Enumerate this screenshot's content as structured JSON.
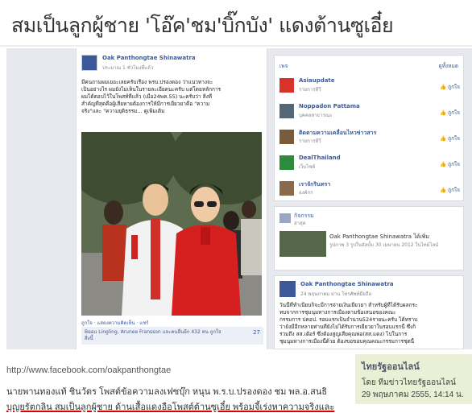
{
  "article": {
    "headline": "สมเป็นลูกผู้ชาย 'โอ๊ค'ชม'บิ๊กบัง' แดงต้านซูเอี๋ย",
    "url": "http://www.facebook.com/oakpanthongtae",
    "body_lines": [
      "นายพานทองแท้ ชินวัตร โพสต์ข้อความลงเฟซบุ๊ก หนุน พ.ร.บ.ปรองดอง ชม พล.อ.สนธิ",
      "บุญยรัตกลิน สมเป็นลูกผู้ชาย ด้านเสื้อแดงอือโพสต์ต้านซูเอี๋ย พร้อมจี้เร่งหาความจริงและ"
    ],
    "credit": {
      "title": "ไทยรัฐออนไลน์",
      "by": "โดย ทีมข่าวไทยรัฐออนไลน์",
      "date": "29 พฤษภาคม 2555, 14:14 น."
    }
  },
  "facebook": {
    "post": {
      "author": "Oak Panthongtae Shinawatra",
      "time": "ประมาณ 1 ชั่วโมงที่แล้ว",
      "text_lines": [
        "มีคนถามผมเยอะเลยครับเรื่อง พรบ.ปรองดอง ว่าแนวทางจะ",
        "เป็นอย่างไร ผมยังไม่เห็นในรายละเอียดนะครับ แต่โดยหลักการ",
        "ผมได้ตอบไว้ในโพสท์ที่แล้ว (เมื่อ24พค.55) นะครับว่า สิ่งที่",
        "สำคัญที่สุดคือผู้เสียหายต้องการให้มีการเยียวยาคือ \"ความ",
        "จริง\"และ \"ความยุติธรรม... ดูเพิ่มเติม"
      ],
      "actions": "ถูกใจ · แสดงความคิดเห็น · แชร์",
      "likes_line1": "Beau Lingling, Arunee Fransson และคนอื่นอีก 432 คน ถูกใจ",
      "likes_line2": "สิ่งนี้",
      "comment_count": "27"
    },
    "pages_panel": {
      "header": "เพจ",
      "see_more": "ดูทั้งหมด",
      "like_label": "ถูกใจ",
      "items": [
        {
          "title": "Asiaupdate",
          "sub": "รายการทีวี",
          "icon_color": "#d8322b"
        },
        {
          "title": "Noppadon Pattama",
          "sub": "บุคคลสาธารณะ",
          "icon_color": "#556677"
        },
        {
          "title": "ติดตามความเคลื่อนไหวข่าวสาร",
          "sub": "รายการทีวี",
          "icon_color": "#7a5c3a"
        },
        {
          "title": "DealThailand",
          "sub": "เว็บไซต์",
          "icon_color": "#2d8b3c"
        },
        {
          "title": "เราจักรินทรา",
          "sub": "องค์กร",
          "icon_color": "#8a6a4a"
        }
      ]
    },
    "activity": {
      "title": "กิจกรรม",
      "sub": "ล่าสุด",
      "name": "Oak Panthongtae Shinawatra ได้เพิ่ม",
      "detail": "รูปภาพ 3 รูปในอัลบั้ม 30 เมษายน 2012 ในไทม์ไลน์"
    },
    "post2": {
      "author": "Oak Panthongtae Shinawatra",
      "time": "24 พฤษภาคม ผ่าน โทรศัพท์มือถือ",
      "text_lines": [
        "วันนี้ที่ทำเนียบก็จะมีการจ่ายเงินเยียวยา สำหรับผู้ที่ได้รับผลกระ",
        "ทบจากการชุมนุมทางการเมืองตามข้อเสนอของคณะ",
        "กรรมการ ปคอป. รอบแรกเป็นจำนวน524รายนะครับ ได้ทราบ",
        "ว่ายังมีอีกหลายท่านที่ยังไม่ได้รับการเยียวยาในรอบแรกนี้ ซึ่งก็",
        "รวมถึง สส.เต้อร์ ซึ่งต้องสูญเสียคุณพ่อ(สส.แดง) ไปในการ",
        "ชุมนุมทางการเมืองนี้ด้วย ต้องขอขอบคุณคณะกรรมการชุดนี้"
      ]
    }
  },
  "colors": {
    "facebook_blue": "#3b5998",
    "credit_bg": "#e9f0d6",
    "highlight_underline": "#dd0000"
  }
}
